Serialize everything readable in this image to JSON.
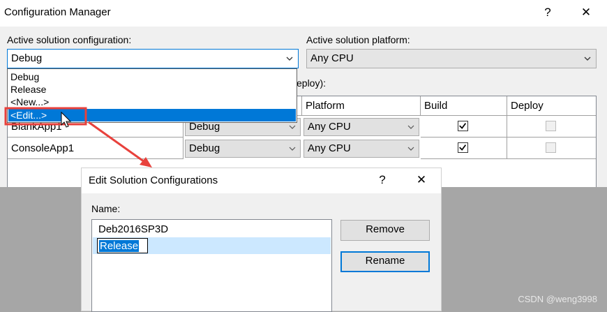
{
  "config_manager": {
    "title": "Configuration Manager",
    "help_glyph": "?",
    "close_glyph": "✕",
    "active_config_label": "Active solution configuration:",
    "active_config_value": "Debug",
    "active_platform_label": "Active solution platform:",
    "active_platform_value": "Any CPU",
    "project_contexts_label_tail": "eploy):",
    "dropdown_options": [
      "Debug",
      "Release",
      "<New...>",
      "<Edit...>"
    ],
    "dropdown_selected_index": 3,
    "grid": {
      "columns": [
        "Platform",
        "Build",
        "Deploy"
      ],
      "rows": [
        {
          "project": "BlankApp1",
          "configuration": "Debug",
          "platform": "Any CPU",
          "build": true,
          "deploy": false
        },
        {
          "project": "ConsoleApp1",
          "configuration": "Debug",
          "platform": "Any CPU",
          "build": true,
          "deploy": false
        }
      ]
    }
  },
  "edit_dialog": {
    "title": "Edit Solution Configurations",
    "help_glyph": "?",
    "close_glyph": "✕",
    "name_label": "Name:",
    "items": [
      "Deb2016SP3D"
    ],
    "editing_value": "Release",
    "remove_label": "Remove",
    "rename_label": "Rename"
  },
  "watermark": "CSDN @weng3998",
  "colors": {
    "accent": "#0078d7",
    "highlight_row": "#cce8ff",
    "annotation": "#e8413c"
  }
}
